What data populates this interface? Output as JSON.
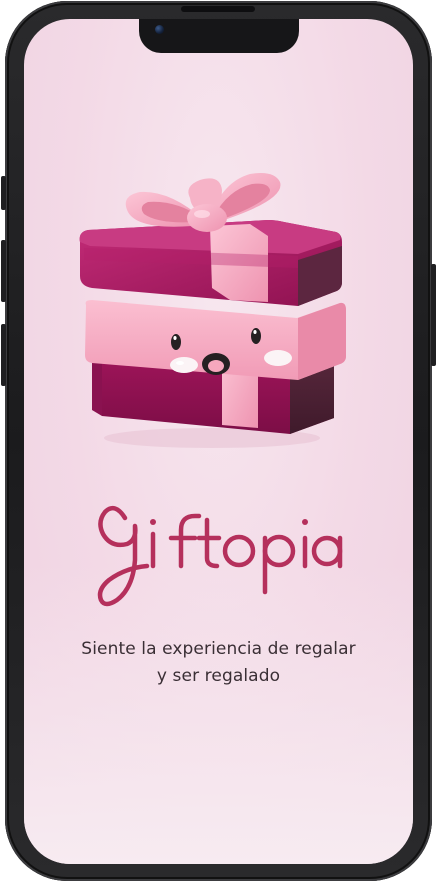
{
  "app": {
    "name": "giftopia",
    "tagline_line1": "Siente la experiencia de regalar",
    "tagline_line2": "y ser regalado"
  },
  "icons": {
    "hero": "gift-box-mascot-icon",
    "camera": "front-camera-icon"
  },
  "colors": {
    "brand": "#b5305c",
    "gift_box": "#a5175d",
    "ribbon": "#f4a7bf",
    "background": "#f3dde8",
    "text": "#3a2f35"
  }
}
